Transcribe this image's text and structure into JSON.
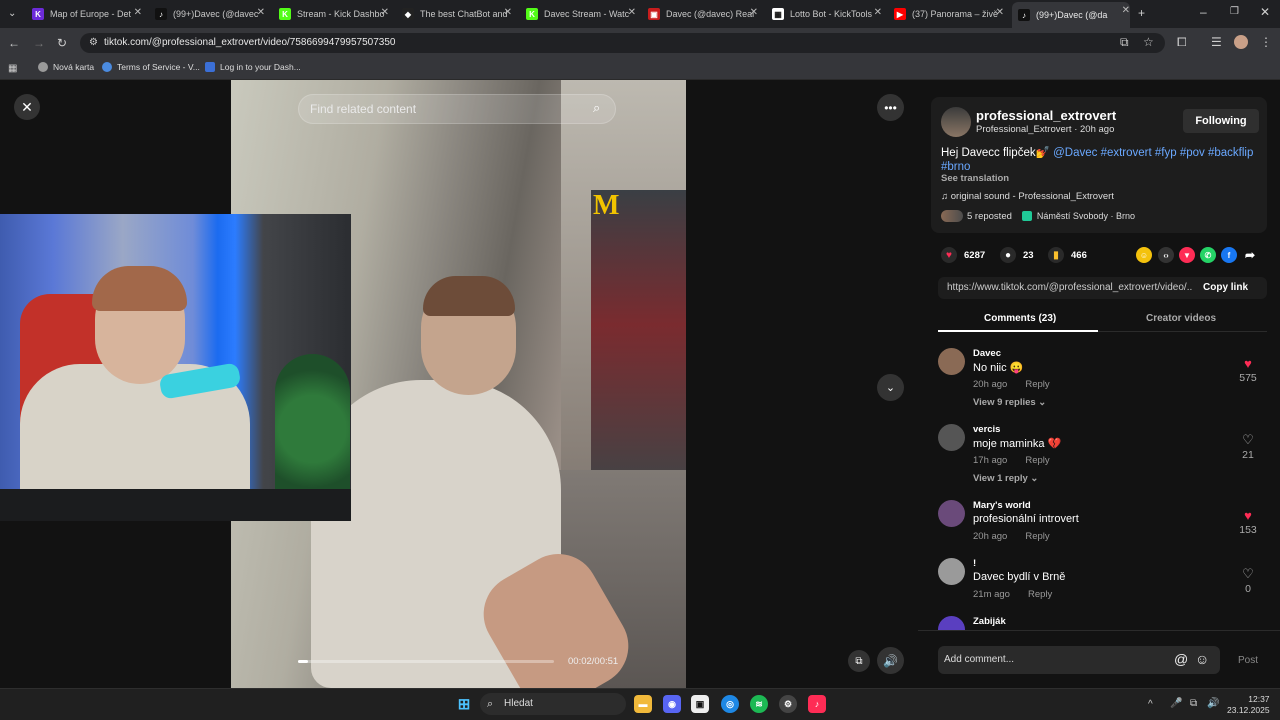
{
  "browser": {
    "tabs": [
      {
        "title": "Map of Europe - Det",
        "color": "#6c2bd9",
        "glyph": "K",
        "active": false
      },
      {
        "title": "(99+)Davec (@davec",
        "color": "#111111",
        "glyph": "♪",
        "active": false
      },
      {
        "title": "Stream - Kick Dashbo",
        "color": "#53fc18",
        "glyph": "K",
        "active": false
      },
      {
        "title": "The best ChatBot and",
        "color": "#222222",
        "glyph": "◆",
        "active": false
      },
      {
        "title": "Davec Stream - Watc",
        "color": "#53fc18",
        "glyph": "K",
        "active": false
      },
      {
        "title": "Davec (@davec) Real",
        "color": "#c81d1d",
        "glyph": "▣",
        "active": false
      },
      {
        "title": "Lotto Bot - KickTools",
        "color": "#ffffff",
        "glyph": "▦",
        "active": false
      },
      {
        "title": "(37) Panorama – živě",
        "color": "#ff0000",
        "glyph": "▶",
        "active": false
      },
      {
        "title": "(99+)Davec (@da",
        "color": "#111111",
        "glyph": "♪",
        "active": true
      }
    ],
    "url": "tiktok.com/@professional_extrovert/video/7586699479957507350",
    "bookmarks": [
      {
        "label": "Nová karta",
        "color": "#9a9a9a"
      },
      {
        "label": "Terms of Service - V...",
        "color": "#4b8be0"
      },
      {
        "label": "Log in to your Dash...",
        "color": "#3b6fd6"
      }
    ]
  },
  "video": {
    "search_placeholder": "Find related content",
    "time": "00:02/00:51",
    "progress": 0.04
  },
  "post": {
    "username": "professional_extrovert",
    "subline": "Professional_Extrovert · 20h ago",
    "follow_label": "Following",
    "caption": "Hej Davecc flipček💅 ",
    "hashtags": "@Davec #extrovert #fyp #pov #backflip #brno",
    "see_translation": "See translation",
    "sound": "original sound - Professional_Extrovert",
    "reposted": "5 reposted",
    "location": "Náměstí Svobody · Brno",
    "likes": "6287",
    "comments": "23",
    "saves": "466",
    "link": "https://www.tiktok.com/@professional_extrovert/video/...",
    "copy_label": "Copy link"
  },
  "tabs": {
    "comments": "Comments (23)",
    "creator": "Creator videos"
  },
  "comments": [
    {
      "name": "Davec",
      "text": "No niic 😛",
      "time": "20h ago",
      "reply": "Reply",
      "likes": "575",
      "liked": true,
      "replies": "View 9 replies ⌄",
      "color": "#8a6a55"
    },
    {
      "name": "vercis",
      "text": "moje maminka 💔",
      "time": "17h ago",
      "reply": "Reply",
      "likes": "21",
      "liked": false,
      "replies": "View 1 reply ⌄",
      "color": "#555555"
    },
    {
      "name": "Mary's world",
      "text": "profesionální introvert",
      "time": "20h ago",
      "reply": "Reply",
      "likes": "153",
      "liked": true,
      "replies": "",
      "color": "#6a4a7a"
    },
    {
      "name": "!",
      "text": "Davec bydlí v Brně",
      "time": "21m ago",
      "reply": "Reply",
      "likes": "0",
      "liked": false,
      "replies": "",
      "color": "#9a9a9a"
    },
    {
      "name": "Zabiják",
      "text": "",
      "time": "",
      "reply": "",
      "likes": "",
      "liked": false,
      "replies": "",
      "color": "#5a3fc0"
    }
  ],
  "add_comment": {
    "placeholder": "Add comment...",
    "post_label": "Post"
  },
  "taskbar": {
    "search": "Hledat",
    "time": "12:37",
    "date": "23.12.2025"
  }
}
